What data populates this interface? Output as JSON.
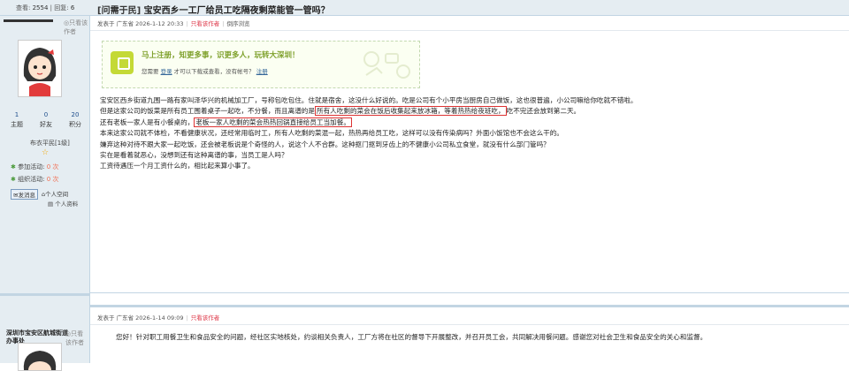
{
  "header": {
    "stats": {
      "views_label": "查看:",
      "views": "2554",
      "replies_label": "回复:",
      "replies": "6"
    },
    "thread_title_tag": "[问需于民]",
    "thread_title": "宝安西乡一工厂给员工吃隔夜剩菜能管一管吗？"
  },
  "post1": {
    "view_label": "只看该作者",
    "meta": {
      "posted": "发表于 广东省 2026-1-12 20:33",
      "author_only": "只看该作者",
      "reverse": "倒序浏览"
    },
    "author": {
      "counts": [
        {
          "value": "1",
          "label": "主题"
        },
        {
          "value": "0",
          "label": "好友"
        },
        {
          "value": "20",
          "label": "积分"
        }
      ],
      "rank": "布衣平民[1级]",
      "participate": {
        "label": "参加活动:",
        "value": "0 次"
      },
      "launch": {
        "label": "组织活动:",
        "value": "0 次"
      },
      "send_msg": "发消息",
      "space": "个人空间",
      "profile": "个人资料"
    },
    "register_box": {
      "title": "马上注册，知更多事，识更多人，玩转大深圳！",
      "text_before": "您需要",
      "login": "登录",
      "text_mid": "才可以下载或查看，没有帐号？",
      "register": "注册"
    },
    "lines": [
      "宝安区西乡街道九围一路有家叫泽华兴的机械加工厂，号称包吃包住。住就是宿舍，这没什么好说的。吃是公司有个小平房当厨房自己做饭，这也很普遍，小公司嘛给你吃就不错啦。",
      {
        "pre": "但是这家公司的饭菜是所有员工围着桌子一起吃，不分餐，而且离谱的是",
        "boxed": "所有人吃剩的菜会在饭后收集起来放冰箱，等着热热给夜班吃，",
        "post": "吃不完还会放到第二天。"
      },
      {
        "pre": "还有老板一家人是有小餐桌的，",
        "boxed": "老板一家人吃剩的菜会热热回锅直接给员工当加餐。",
        "post": ""
      },
      "本来这家公司就不体检，不看健康状况，还经常用临时工，所有人吃剩的菜混一起，热热再给员工吃，这样可以没有传染病吗？外面小饭馆也不会这么干的。",
      "嫌弃这种对待不跟大家一起吃饭，还会被老板说是个奇怪的人，说这个人不合群。这种抠门抠到牙齿上的不健康小公司私立食堂，就没有什么部门管吗？",
      "实在是看着就恶心，没想到还有这种离谱的事，当员工是人吗？",
      "工资待遇压一个月工资什么的，相比起来算小事了。"
    ]
  },
  "post2": {
    "author_name": "深圳市宝安区航城街道办事处",
    "view_label": "只看该作者",
    "meta": {
      "posted": "发表于 广东省 2026-1-14 09:09",
      "author_only": "只看该作者"
    },
    "text": "您好！针对职工用餐卫生和食品安全的问题，经社区实地核处，约谈相关负责人，工厂方将在社区的督导下开展整改，并召开员工会，共同解决用餐问题。感谢您对社会卫生和食品安全的关心和监督。"
  },
  "colors": {
    "accent": "#336699",
    "header_bg": "#e5edf2",
    "highlight_border": "#dd3333",
    "register_green": "#7ea02b"
  }
}
